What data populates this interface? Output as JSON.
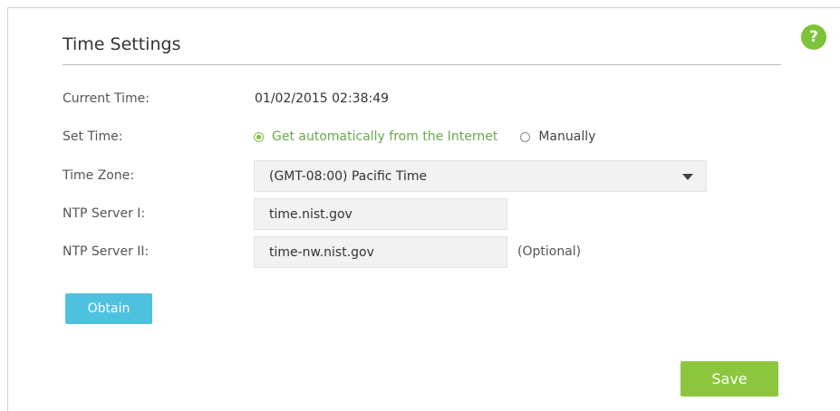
{
  "page": {
    "title": "Time Settings",
    "help_glyph": "?",
    "help_icon": "question-mark-circle-icon"
  },
  "colors": {
    "accent_green": "#7cc33b",
    "obtain_blue": "#4fc1e0",
    "save_green": "#8cc63f"
  },
  "current_time": {
    "label": "Current Time:",
    "value": "01/02/2015 02:38:49"
  },
  "set_time": {
    "label": "Set Time:",
    "options": [
      {
        "label": "Get automatically from the Internet",
        "selected": true
      },
      {
        "label": "Manually",
        "selected": false
      }
    ]
  },
  "time_zone": {
    "label": "Time Zone:",
    "selected": "(GMT-08:00) Pacific Time",
    "icon": "caret-down-icon"
  },
  "ntp1": {
    "label": "NTP Server I:",
    "value": "time.nist.gov"
  },
  "ntp2": {
    "label": "NTP Server II:",
    "value": "time-nw.nist.gov",
    "hint": "(Optional)"
  },
  "buttons": {
    "obtain": "Obtain",
    "save": "Save"
  }
}
